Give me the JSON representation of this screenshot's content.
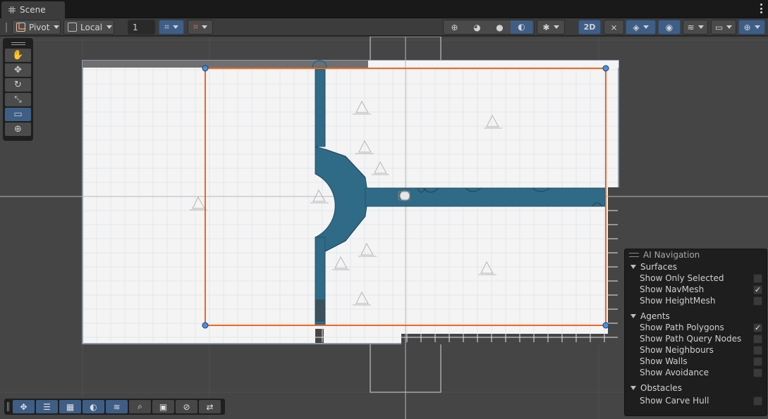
{
  "tab": {
    "title": "Scene",
    "icon": "grid-icon"
  },
  "toolbar": {
    "pivot_label": "Pivot",
    "space_label": "Local",
    "grid_increment_value": "1",
    "mode_2d_label": "2D"
  },
  "tools": [
    {
      "name": "hand-tool",
      "glyph": "✋",
      "active": false
    },
    {
      "name": "move-tool",
      "glyph": "✥",
      "active": false
    },
    {
      "name": "rotate-tool",
      "glyph": "↻",
      "active": false
    },
    {
      "name": "scale-tool",
      "glyph": "⤡",
      "active": false
    },
    {
      "name": "rect-tool",
      "glyph": "▭",
      "active": true
    },
    {
      "name": "transform-tool",
      "glyph": "⊕",
      "active": false
    }
  ],
  "ai_navigation": {
    "title": "AI Navigation",
    "sections": [
      {
        "label": "Surfaces",
        "items": [
          {
            "label": "Show Only Selected",
            "checked": false
          },
          {
            "label": "Show NavMesh",
            "checked": true
          },
          {
            "label": "Show HeightMesh",
            "checked": false
          }
        ]
      },
      {
        "label": "Agents",
        "items": [
          {
            "label": "Show Path Polygons",
            "checked": true
          },
          {
            "label": "Show Path Query Nodes",
            "checked": false
          },
          {
            "label": "Show Neighbours",
            "checked": false
          },
          {
            "label": "Show Walls",
            "checked": false
          },
          {
            "label": "Show Avoidance",
            "checked": false
          }
        ]
      },
      {
        "label": "Obstacles",
        "items": [
          {
            "label": "Show Carve Hull",
            "checked": false
          }
        ]
      }
    ]
  },
  "colors": {
    "selection_orange": "#f0661e",
    "navmesh_blue": "#2f6a86",
    "handle_blue": "#4a8ee0",
    "accent_blue": "#3e5e86"
  }
}
